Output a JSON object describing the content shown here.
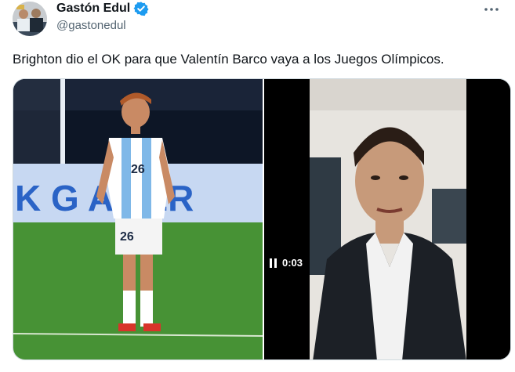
{
  "author": {
    "display_name": "Gastón Edul",
    "handle": "@gastonedul",
    "verified_color": "#1d9bf0"
  },
  "tweet": {
    "text": "Brighton dio el OK para que Valentín Barco vaya a los Juegos Olímpicos."
  },
  "media": {
    "photo": {
      "jersey_number": "26",
      "banner_text": "K G  AMÉR"
    },
    "video": {
      "elapsed": "0:03"
    }
  },
  "icons": {
    "more": "more-options-icon",
    "verified": "verified-badge-icon",
    "pause": "pause-icon"
  }
}
